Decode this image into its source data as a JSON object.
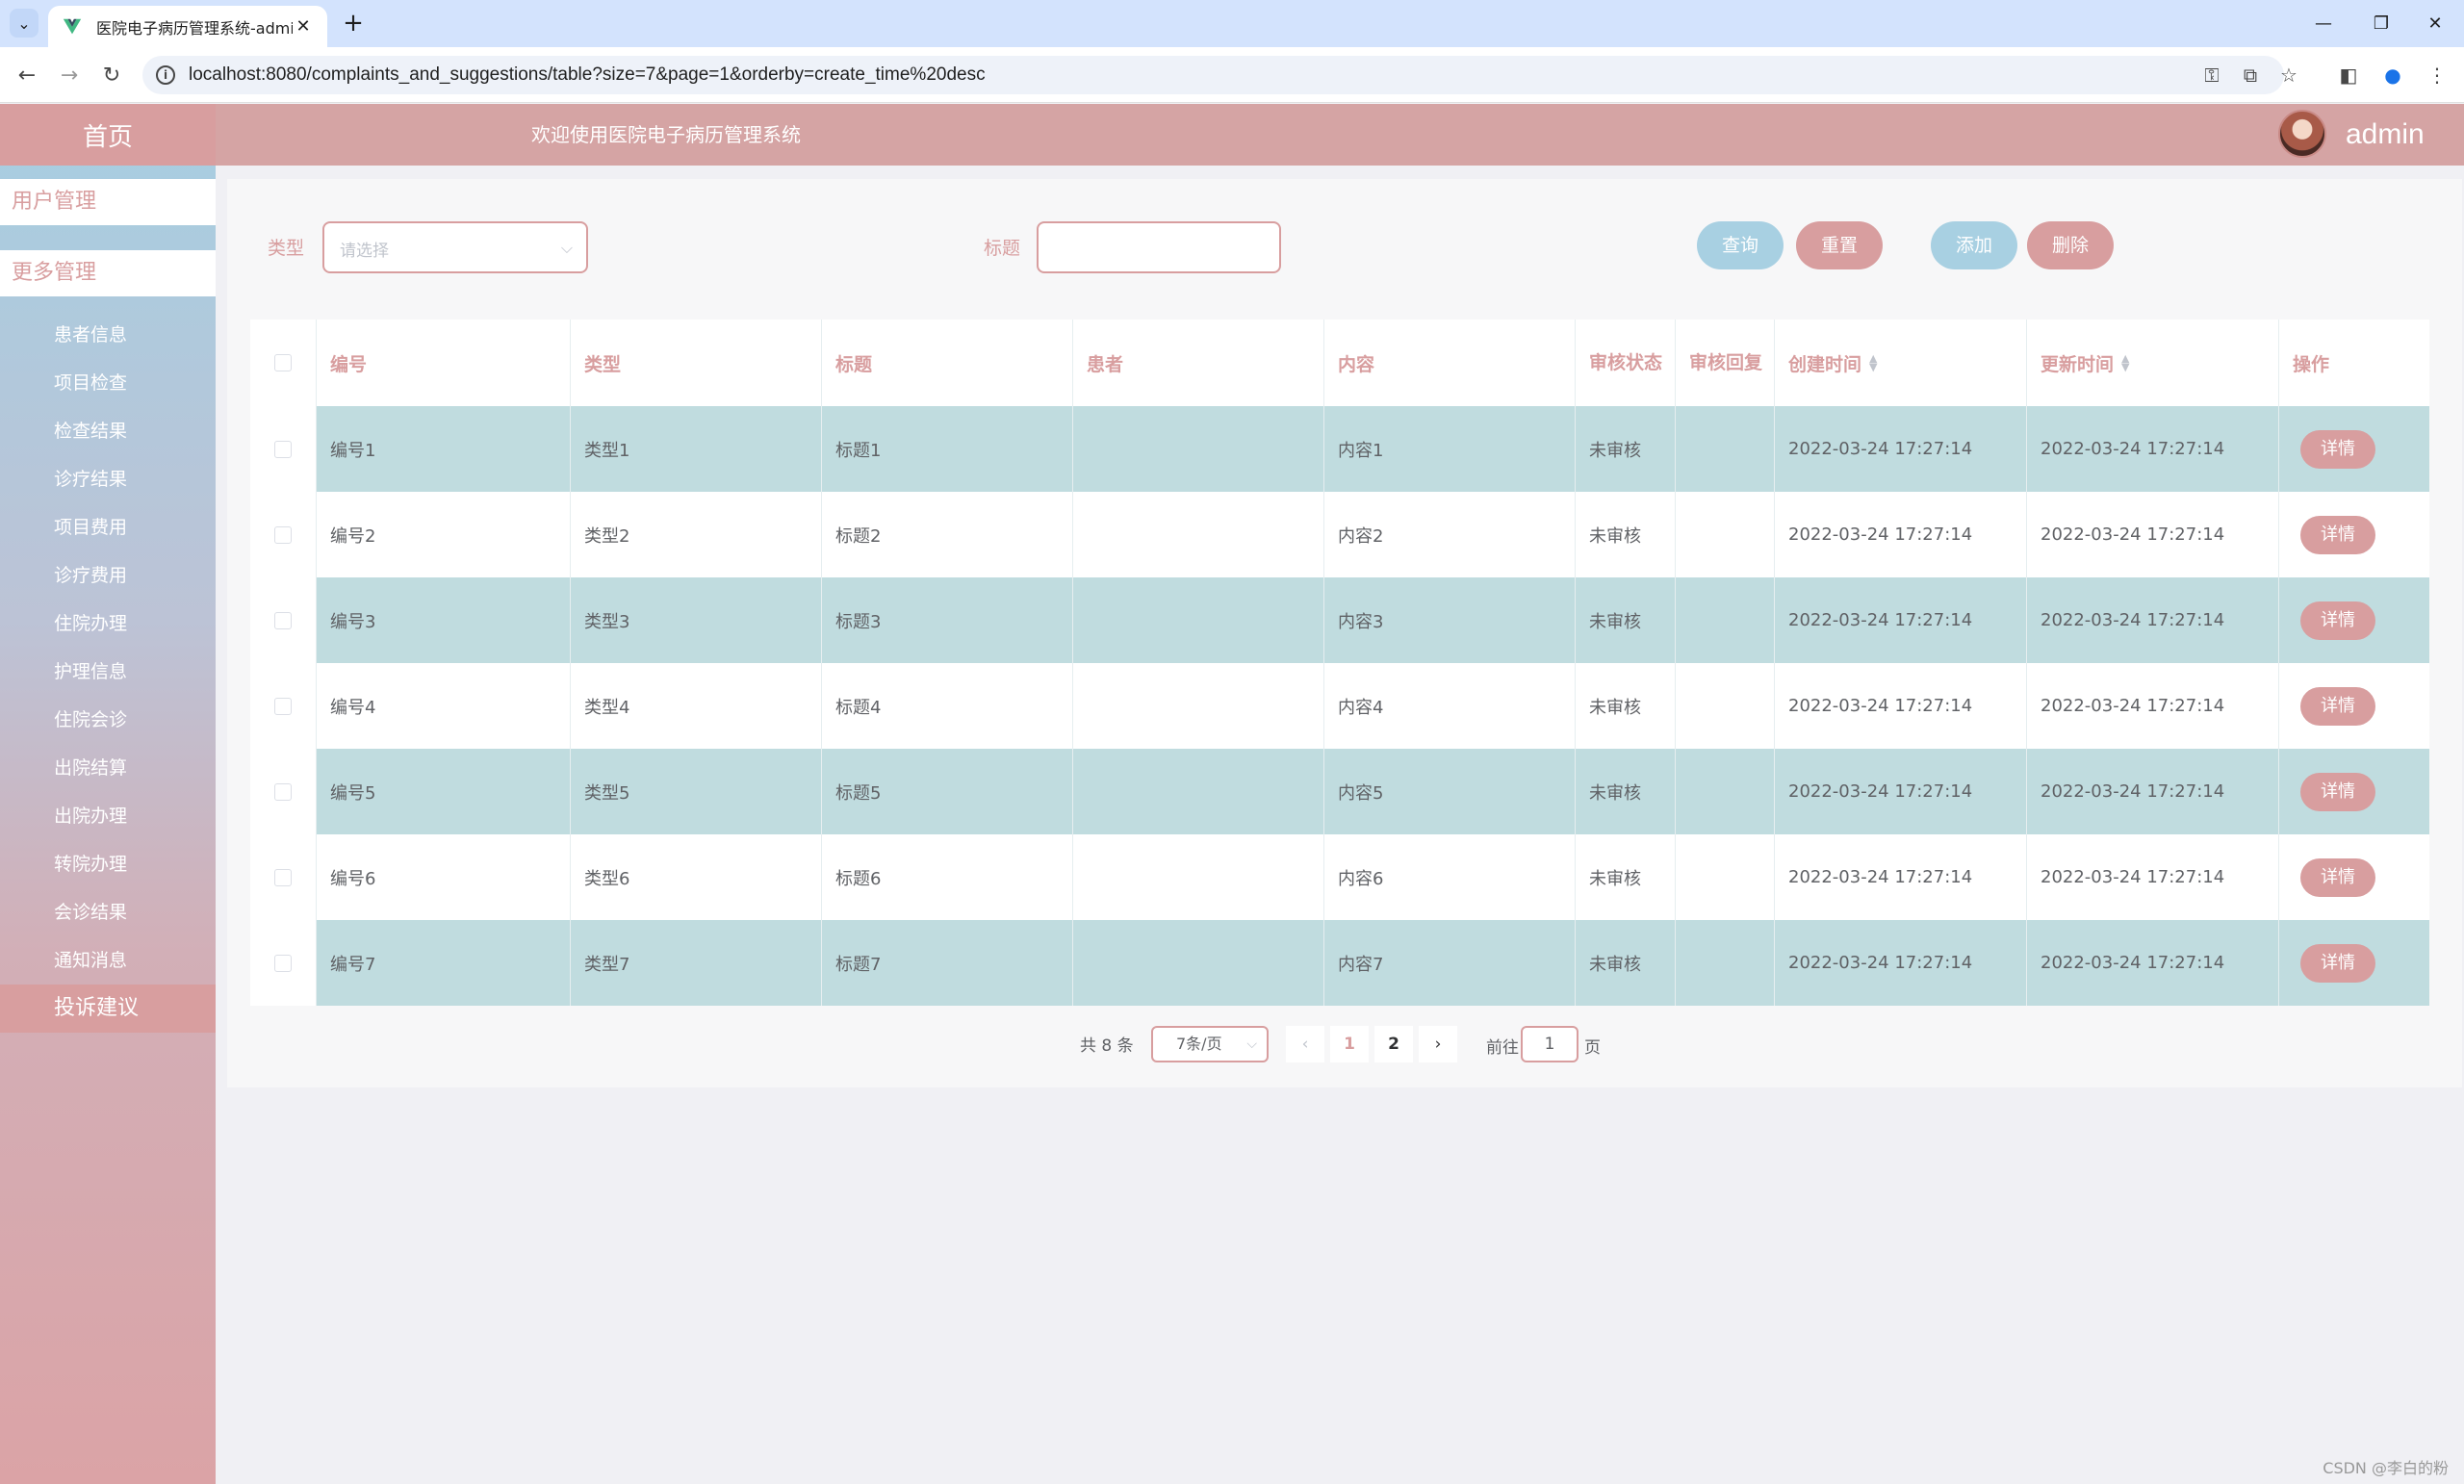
{
  "browser": {
    "tab_title": "医院电子病历管理系统-admin",
    "url": "localhost:8080/complaints_and_suggestions/table?size=7&page=1&orderby=create_time%20desc"
  },
  "header": {
    "home": "首页",
    "welcome": "欢迎使用医院电子病历管理系统",
    "username": "admin"
  },
  "sidebar": {
    "groups": [
      "用户管理",
      "更多管理"
    ],
    "items": [
      "患者信息",
      "项目检查",
      "检查结果",
      "诊疗结果",
      "项目费用",
      "诊疗费用",
      "住院办理",
      "护理信息",
      "住院会诊",
      "出院结算",
      "出院办理",
      "转院办理",
      "会诊结果",
      "通知消息",
      "投诉建议"
    ],
    "active_index": 14
  },
  "filters": {
    "type_label": "类型",
    "type_placeholder": "请选择",
    "title_label": "标题",
    "title_value": ""
  },
  "buttons": {
    "query": "查询",
    "reset": "重置",
    "add": "添加",
    "delete": "删除"
  },
  "table": {
    "headers": [
      "编号",
      "类型",
      "标题",
      "患者",
      "内容",
      "审核状态",
      "审核回复",
      "创建时间",
      "更新时间",
      "操作"
    ],
    "rows": [
      [
        "编号1",
        "类型1",
        "标题1",
        "",
        "内容1",
        "未审核",
        "",
        "2022-03-24 17:27:14",
        "2022-03-24 17:27:14",
        "详情"
      ],
      [
        "编号2",
        "类型2",
        "标题2",
        "",
        "内容2",
        "未审核",
        "",
        "2022-03-24 17:27:14",
        "2022-03-24 17:27:14",
        "详情"
      ],
      [
        "编号3",
        "类型3",
        "标题3",
        "",
        "内容3",
        "未审核",
        "",
        "2022-03-24 17:27:14",
        "2022-03-24 17:27:14",
        "详情"
      ],
      [
        "编号4",
        "类型4",
        "标题4",
        "",
        "内容4",
        "未审核",
        "",
        "2022-03-24 17:27:14",
        "2022-03-24 17:27:14",
        "详情"
      ],
      [
        "编号5",
        "类型5",
        "标题5",
        "",
        "内容5",
        "未审核",
        "",
        "2022-03-24 17:27:14",
        "2022-03-24 17:27:14",
        "详情"
      ],
      [
        "编号6",
        "类型6",
        "标题6",
        "",
        "内容6",
        "未审核",
        "",
        "2022-03-24 17:27:14",
        "2022-03-24 17:27:14",
        "详情"
      ],
      [
        "编号7",
        "类型7",
        "标题7",
        "",
        "内容7",
        "未审核",
        "",
        "2022-03-24 17:27:14",
        "2022-03-24 17:27:14",
        "详情"
      ]
    ]
  },
  "pagination": {
    "total": "共 8 条",
    "page_size": "7条/页",
    "pages": [
      "1",
      "2"
    ],
    "current_page": "1",
    "goto_label": "前往",
    "goto_value": "1",
    "page_suffix": "页"
  },
  "watermark": "CSDN @李白的粉",
  "colors": {
    "accent_pink": "#d89e9f",
    "accent_blue": "#a8d0e2",
    "row_teal": "#c0dcdf"
  }
}
